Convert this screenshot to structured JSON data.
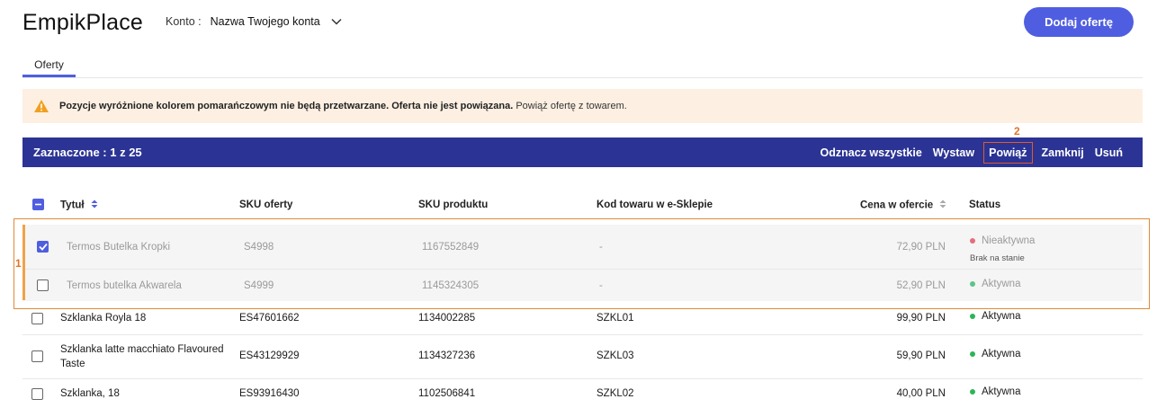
{
  "header": {
    "logo": "EmpikPlace",
    "account_label": "Konto :",
    "account_value": "Nazwa Twojego konta",
    "add_offer_button": "Dodaj ofertę"
  },
  "tabs": [
    {
      "label": "Oferty",
      "active": true
    }
  ],
  "warning": {
    "bold_text": "Pozycje wyróżnione kolorem pomarańczowym nie będą przetwarzane. Oferta nie jest powiązana.",
    "text": "Powiąż ofertę z towarem."
  },
  "selection_bar": {
    "count_text": "Zaznaczone : 1 z 25",
    "actions": [
      "Odznacz wszystkie",
      "Wystaw",
      "Powiąż",
      "Zamknij",
      "Usuń"
    ]
  },
  "annotations": {
    "group_marker": "1",
    "action_marker": "2"
  },
  "table": {
    "columns": [
      "Tytuł",
      "SKU oferty",
      "SKU produktu",
      "Kod towaru w e-Sklepie",
      "Cena w ofercie",
      "Status"
    ],
    "rows": [
      {
        "checked": true,
        "title": "Termos Butelka Kropki",
        "sku_offer": "S4998",
        "sku_product": "1167552849",
        "shop_code": "-",
        "price": "72,90 PLN",
        "status": "Nieaktywna",
        "status_sub": "Brak na stanie"
      },
      {
        "checked": false,
        "title": "Termos butelka Akwarela",
        "sku_offer": "S4999",
        "sku_product": "1145324305",
        "shop_code": "-",
        "price": "52,90 PLN",
        "status": "Aktywna",
        "status_sub": ""
      },
      {
        "checked": false,
        "title": "Szklanka Royla 18",
        "sku_offer": "ES47601662",
        "sku_product": "1134002285",
        "shop_code": "SZKL01",
        "price": "99,90 PLN",
        "status": "Aktywna",
        "status_sub": ""
      },
      {
        "checked": false,
        "title_line1": "Szklanka latte macchiato Flavoured",
        "title_line2": "Taste",
        "sku_offer": "ES43129929",
        "sku_product": "1134327236",
        "shop_code": "SZKL03",
        "price": "59,90 PLN",
        "status": "Aktywna",
        "status_sub": ""
      },
      {
        "checked": false,
        "title": "Szklanka, 18",
        "sku_offer": "ES93916430",
        "sku_product": "1102506841",
        "shop_code": "SZKL02",
        "price": "40,00 PLN",
        "status": "Aktywna",
        "status_sub": ""
      }
    ]
  },
  "colors": {
    "accent": "#4f5ee0",
    "selection_bar": "#2b3494",
    "warning_bg": "#fdf0e2",
    "highlight": "#e08a3a"
  },
  "icons": [
    "chevron-down-icon",
    "warning-icon",
    "sort-icon",
    "checkbox-icon"
  ]
}
